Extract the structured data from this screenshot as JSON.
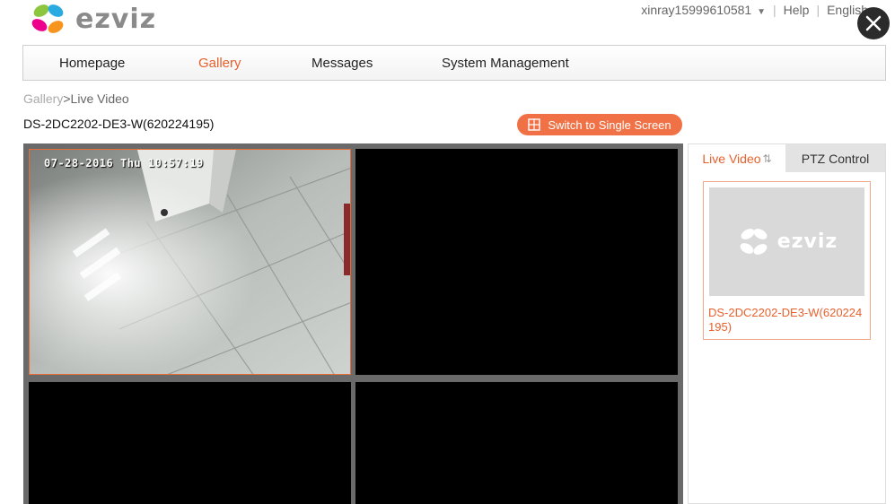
{
  "brand": {
    "name": "ezviz"
  },
  "topbar": {
    "username": "xinray15999610581",
    "help": "Help",
    "language": "English"
  },
  "nav": {
    "items": [
      {
        "label": "Homepage"
      },
      {
        "label": "Gallery"
      },
      {
        "label": "Messages"
      },
      {
        "label": "System Management"
      }
    ],
    "active": "Gallery"
  },
  "breadcrumb": {
    "parent": "Gallery",
    "separator": ">",
    "current": "Live Video"
  },
  "device": {
    "title": "DS-2DC2202-DE3-W(620224195)"
  },
  "toolbar": {
    "switch_label": "Switch to Single Screen"
  },
  "video": {
    "osd_timestamp": "07-28-2016 Thu 10:57:19"
  },
  "panel": {
    "tabs": [
      {
        "label": "Live Video"
      },
      {
        "label": "PTZ Control"
      }
    ],
    "device_card": {
      "label": "DS-2DC2202-DE3-W(620224195)"
    }
  },
  "colors": {
    "accent": "#e8602c",
    "button": "#f07146",
    "grid_bg": "#6a6a6a"
  }
}
